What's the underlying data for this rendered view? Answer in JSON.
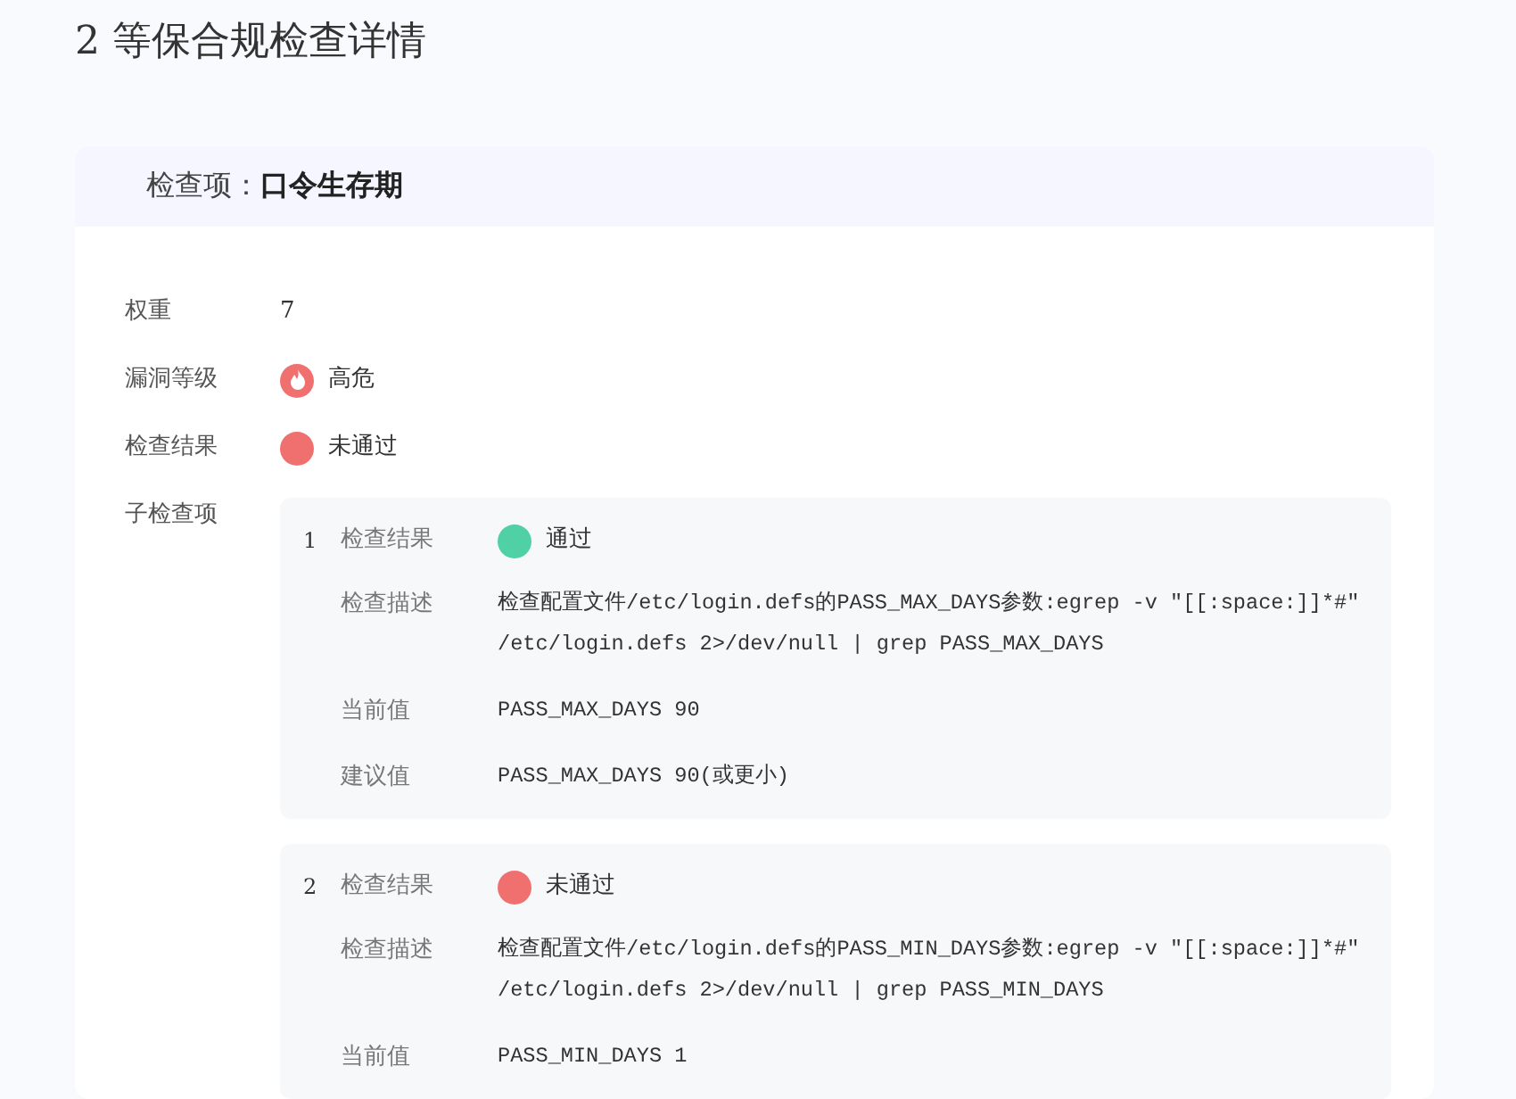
{
  "page_title": "2 等保合规检查详情",
  "check_item": {
    "label": "检查项：",
    "name": "口令生存期",
    "fields": [
      {
        "kind": "text",
        "label": "权重",
        "value": "7"
      },
      {
        "kind": "severity",
        "label": "漏洞等级",
        "value": "高危",
        "color": "#f07070"
      },
      {
        "kind": "result",
        "label": "检查结果",
        "value": "未通过",
        "passed": false
      }
    ],
    "sub_label": "子检查项",
    "sub_checks": [
      {
        "index": "1",
        "result_label": "检查结果",
        "result": "通过",
        "passed": true,
        "fields": [
          {
            "label": "检查描述",
            "value": "检查配置文件/etc/login.defs的PASS_MAX_DAYS参数:egrep -v ″[[:space:]]*#″ /etc/login.defs 2>/dev/null | grep PASS_MAX_DAYS"
          },
          {
            "label": "当前值",
            "value": "PASS_MAX_DAYS 90"
          },
          {
            "label": "建议值",
            "value": "PASS_MAX_DAYS 90(或更小)"
          }
        ]
      },
      {
        "index": "2",
        "result_label": "检查结果",
        "result": "未通过",
        "passed": false,
        "fields": [
          {
            "label": "检查描述",
            "value": "检查配置文件/etc/login.defs的PASS_MIN_DAYS参数:egrep -v ″[[:space:]]*#″ /etc/login.defs 2>/dev/null | grep PASS_MIN_DAYS"
          },
          {
            "label": "当前值",
            "value": "PASS_MIN_DAYS 1"
          }
        ]
      }
    ]
  }
}
